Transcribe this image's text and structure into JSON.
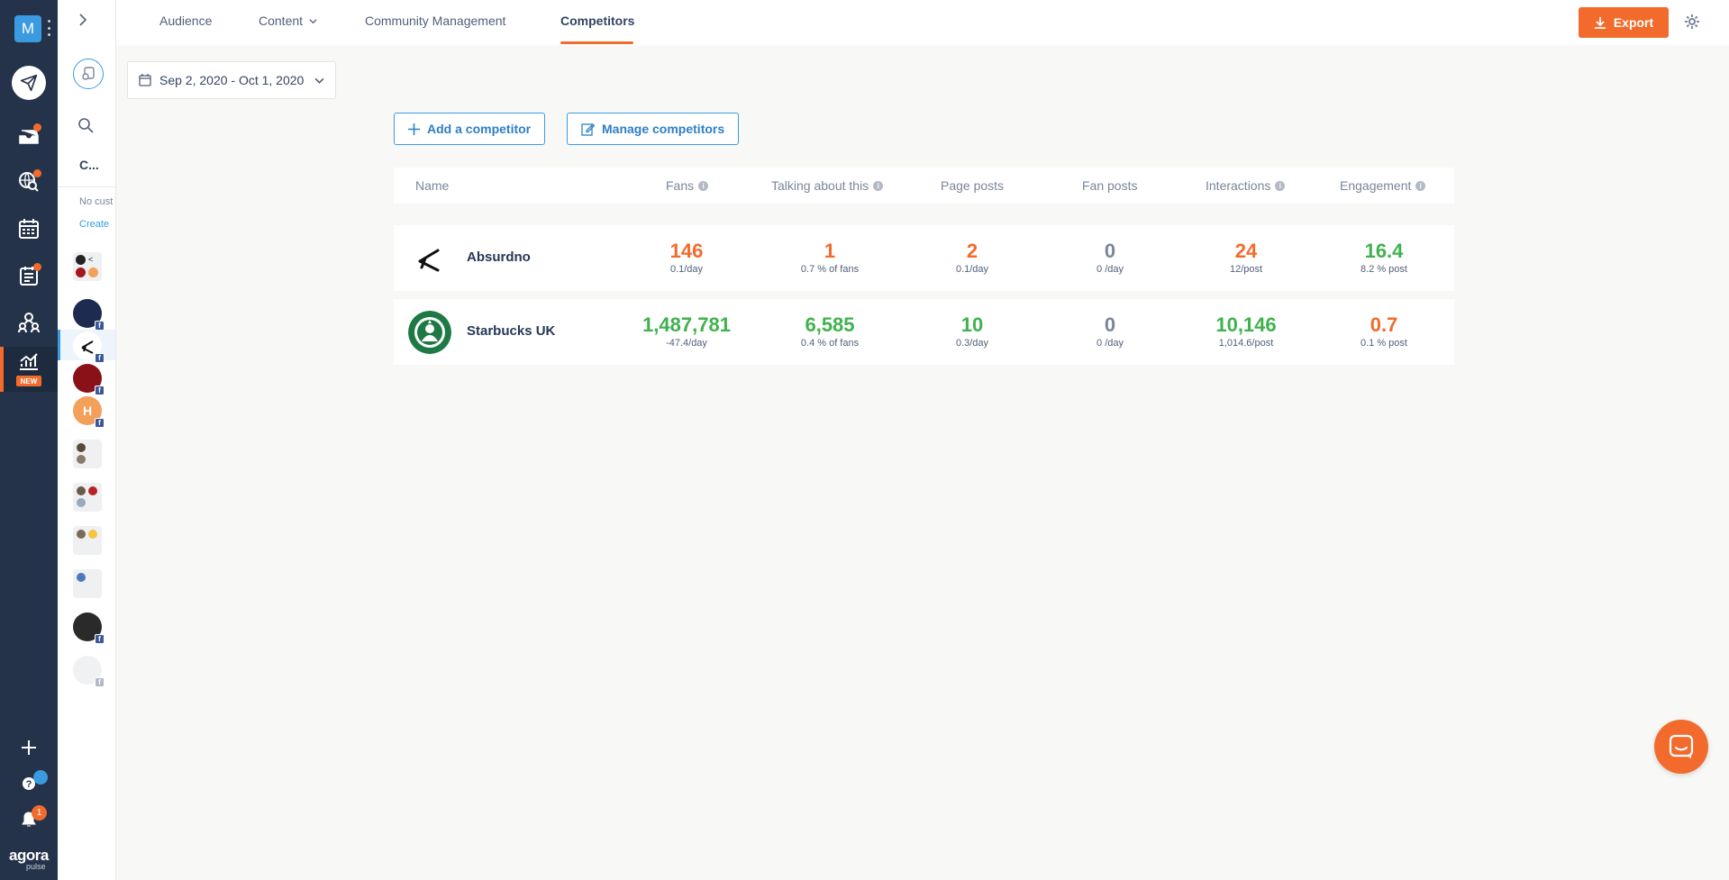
{
  "nav": {
    "workspace_initial": "M",
    "new_badge": "NEW",
    "notifications_count": "1",
    "logo": "agora",
    "logo_sub": "pulse",
    "icons": [
      "publish-icon",
      "inbox-icon",
      "listening-icon",
      "calendar-icon",
      "reports-icon",
      "team-icon",
      "analytics-icon",
      "add-icon",
      "help-icon",
      "bell-icon"
    ]
  },
  "sidebar": {
    "collapsed_title": "C...",
    "no_customers_text": "No cust",
    "create_link": "Create"
  },
  "header": {
    "tabs": [
      {
        "label": "Audience"
      },
      {
        "label": "Content"
      },
      {
        "label": "Community Management"
      },
      {
        "label": "Competitors"
      }
    ],
    "active_tab": "Competitors",
    "export_label": "Export"
  },
  "date_range": "Sep 2, 2020 - Oct 1, 2020",
  "buttons": {
    "add_competitor": "Add a competitor",
    "manage_competitors": "Manage competitors"
  },
  "table": {
    "columns": [
      "Name",
      "Fans",
      "Talking about this",
      "Page posts",
      "Fan posts",
      "Interactions",
      "Engagement"
    ],
    "rows": [
      {
        "name": "Absurdno",
        "fans": {
          "value": "146",
          "sub": "0.1/day"
        },
        "talking": {
          "value": "1",
          "sub": "0.7 % of fans"
        },
        "page_posts": {
          "value": "2",
          "sub": "0.1/day"
        },
        "fan_posts": {
          "value": "0",
          "sub": "0 /day"
        },
        "interactions": {
          "value": "24",
          "sub": "12/post"
        },
        "engagement": {
          "value": "16.4",
          "sub": "8.2 % post"
        }
      },
      {
        "name": "Starbucks UK",
        "fans": {
          "value": "1,487,781",
          "sub": "-47.4/day"
        },
        "talking": {
          "value": "6,585",
          "sub": "0.4 % of fans"
        },
        "page_posts": {
          "value": "10",
          "sub": "0.3/day"
        },
        "fan_posts": {
          "value": "0",
          "sub": "0 /day"
        },
        "interactions": {
          "value": "10,146",
          "sub": "1,014.6/post"
        },
        "engagement": {
          "value": "0.7",
          "sub": "0.1 % post"
        }
      }
    ]
  },
  "colors": {
    "accent": "#f26b2c",
    "positive": "#3fb24f",
    "link": "#3a9be0",
    "nav_bg": "#25334a"
  }
}
